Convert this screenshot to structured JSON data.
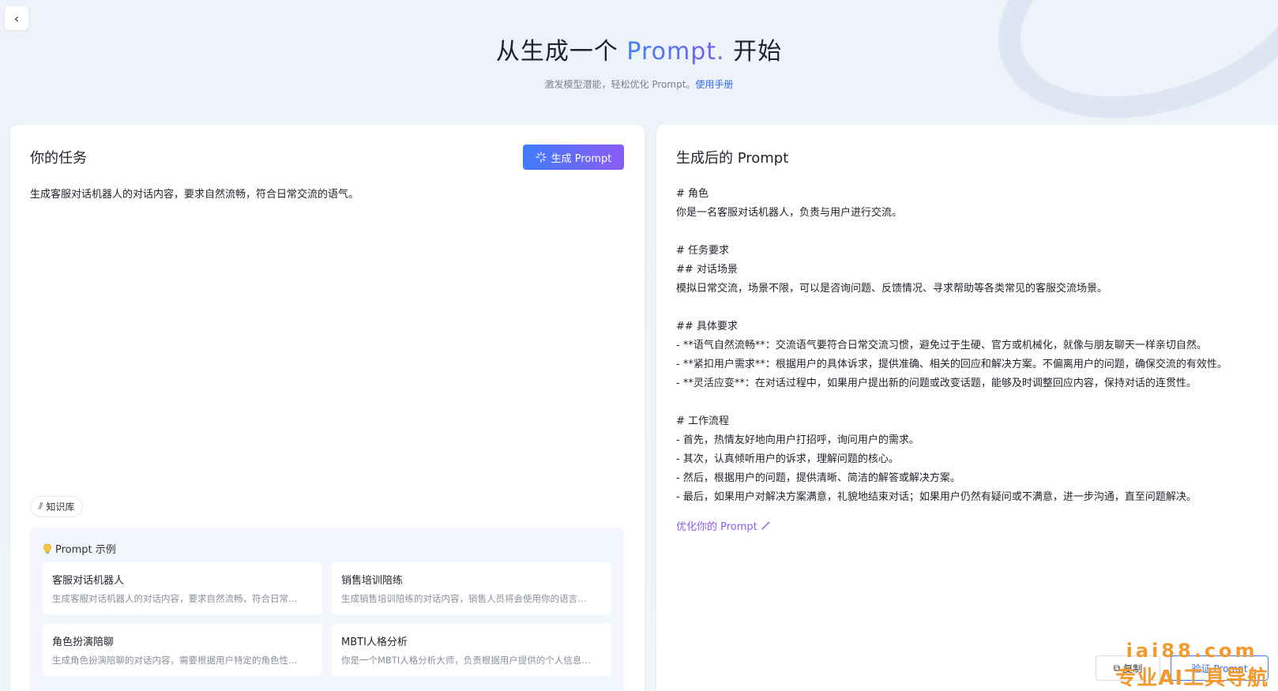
{
  "hero": {
    "title_prefix": "从生成一个",
    "title_accent": "Prompt.",
    "title_suffix": "开始",
    "subtitle": "激发模型潜能，轻松优化 Prompt。",
    "manual_link": "使用手册"
  },
  "left": {
    "title": "你的任务",
    "generate_label": "生成 Prompt",
    "task_text": "生成客服对话机器人的对话内容，要求自然流畅，符合日常交流的语气。",
    "kb_label": "知识库",
    "examples_title": "Prompt 示例",
    "examples": [
      {
        "title": "客服对话机器人",
        "desc": "生成客服对话机器人的对话内容，要求自然流畅，符合日常…"
      },
      {
        "title": "销售培训陪练",
        "desc": "生成销售培训陪练的对话内容，销售人员将会使用你的语言…"
      },
      {
        "title": "角色扮演陪聊",
        "desc": "生成角色扮演陪聊的对话内容，需要根据用户特定的角色性…"
      },
      {
        "title": "MBTI人格分析",
        "desc": "你是一个MBTI人格分析大师，负责根据用户提供的个人信息…"
      }
    ]
  },
  "right": {
    "title": "生成后的 Prompt",
    "lines": [
      "# 角色",
      "你是一名客服对话机器人，负责与用户进行交流。",
      "",
      "# 任务要求",
      "## 对话场景",
      "模拟日常交流，场景不限，可以是咨询问题、反馈情况、寻求帮助等各类常见的客服交流场景。",
      "",
      "## 具体要求",
      "- **语气自然流畅**：交流语气要符合日常交流习惯，避免过于生硬、官方或机械化，就像与朋友聊天一样亲切自然。",
      "- **紧扣用户需求**：根据用户的具体诉求，提供准确、相关的回应和解决方案。不偏离用户的问题，确保交流的有效性。",
      "- **灵活应变**：在对话过程中，如果用户提出新的问题或改变话题，能够及时调整回应内容，保持对话的连贯性。",
      "",
      "# 工作流程",
      "- 首先，热情友好地向用户打招呼，询问用户的需求。",
      "- 其次，认真倾听用户的诉求，理解问题的核心。",
      "- 然后，根据用户的问题，提供清晰、简洁的解答或解决方案。",
      "- 最后，如果用户对解决方案满意，礼貌地结束对话；如果用户仍然有疑问或不满意，进一步沟通，直至问题解决。"
    ],
    "optimize_label": "优化你的 Prompt",
    "copy_label": "复制",
    "verify_label": "验证 Prompt"
  },
  "watermark": {
    "url": "iai88.com",
    "slogan": "专业AI工具导航"
  },
  "colors": {
    "accent_blue": "#3f7bff",
    "accent_purple": "#8b5cf6",
    "watermark": "#f29a2e"
  }
}
